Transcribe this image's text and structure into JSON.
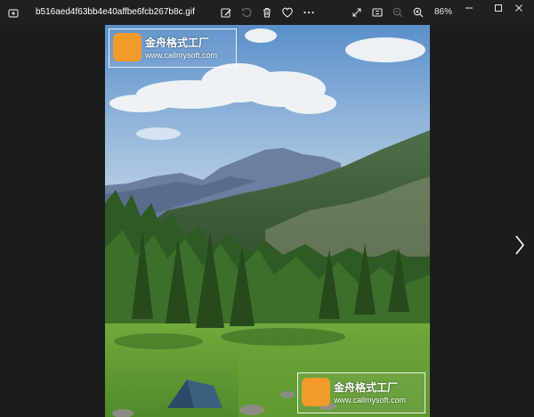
{
  "window": {
    "filename": "b516aed4f63bb4e40affbe6fcb267b8c.gif",
    "zoom_level": "86%"
  },
  "toolbar": {
    "icons": [
      "edit-image-icon",
      "rotate-icon",
      "delete-icon",
      "favorite-icon",
      "more-icon",
      "fullscreen-icon",
      "slideshow-icon",
      "zoom-out-icon",
      "zoom-in-icon"
    ]
  },
  "photo": {
    "description_icon": "mountain-landscape-photo",
    "watermark_top": {
      "title": "金舟格式工厂",
      "url": "www.callmysoft.com"
    },
    "watermark_bottom": {
      "title": "金舟格式工厂",
      "url": "www.callmysoft.com"
    }
  },
  "colors": {
    "background": "#1c1c1c",
    "titlebar": "#202020",
    "watermark_logo": "#f29a2a"
  }
}
